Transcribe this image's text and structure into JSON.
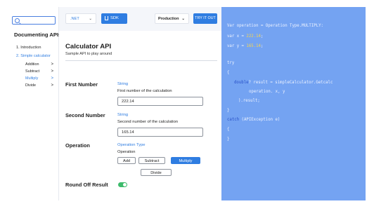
{
  "sidebar": {
    "title": "Documenting APIs",
    "items": [
      {
        "label": "1. Introduction",
        "active": false
      },
      {
        "label": "2. Simple calculator",
        "active": true
      }
    ],
    "sub_items": [
      {
        "label": "Addition",
        "active": false
      },
      {
        "label": "Subtract",
        "active": false
      },
      {
        "label": "Multiply",
        "active": true
      },
      {
        "label": "Divide",
        "active": false
      }
    ],
    "chevron": ">"
  },
  "toolbar": {
    "language": ".NET",
    "sdk_label": "SDK",
    "environment": "Production",
    "try_label": "TRY IT OUT"
  },
  "main": {
    "title": "Calculator API",
    "subtitle": "Sample API to play around",
    "params": [
      {
        "label": "First Number",
        "type": "String",
        "description": "First number of the calculation",
        "value": "222.14"
      },
      {
        "label": "Second Number",
        "type": "String",
        "description": "Second number of the calculation",
        "value": "165.14"
      },
      {
        "label": "Operation",
        "type": "Operation Type",
        "description": "Operation",
        "options": [
          "Add",
          "Subtract",
          "Multiply",
          "Divide"
        ],
        "selected": "Multiply"
      },
      {
        "label": "Round Off Result",
        "toggle_on": true
      }
    ]
  },
  "code": {
    "line1_a": "Var operation",
    "line1_b": " = ",
    "line1_c": "Operation Type.MULTIPLY:",
    "line2_a": "var x = ",
    "line2_num": "222.14",
    "line2_b": ";",
    "line3_a": "var y = ",
    "line3_num": "165.14",
    "line3_b": ";",
    "line4": "try",
    "line5": "{",
    "line6_kw": "double",
    "line6_b": "? result = simpleCalculator.Getcalc",
    "line7": "operation. x, y",
    "line8": ").result;",
    "line9": "}",
    "line10_kw": "catch",
    "line10_b": " (APIException e)",
    "line11": "{",
    "line12": "}"
  },
  "colors": {
    "accent": "#2f7de1",
    "code_bg": "#74a3f2",
    "code_number": "#f8d64e",
    "toggle": "#3dbb6b"
  },
  "icons": [
    "search-icon",
    "chevron-down-icon",
    "download-icon",
    "chevron-right-icon"
  ]
}
